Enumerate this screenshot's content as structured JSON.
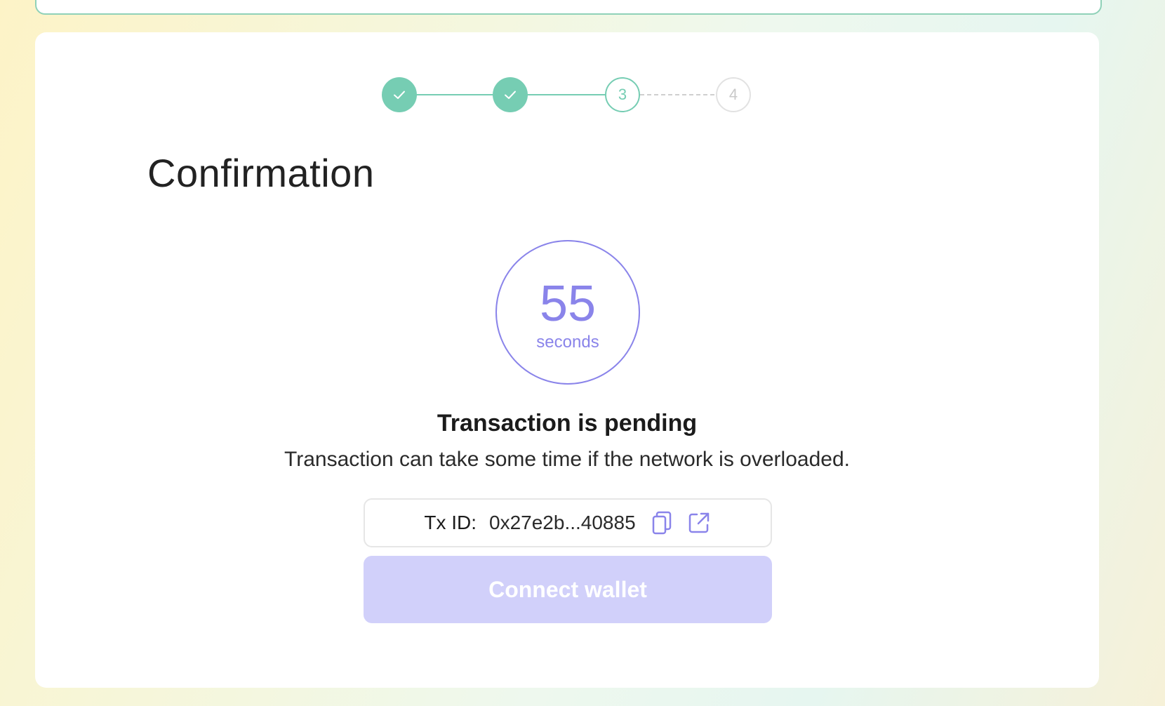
{
  "stepper": {
    "steps": [
      {
        "label": "",
        "state": "done"
      },
      {
        "label": "",
        "state": "done"
      },
      {
        "label": "3",
        "state": "current"
      },
      {
        "label": "4",
        "state": "todo"
      }
    ]
  },
  "page": {
    "title": "Confirmation"
  },
  "timer": {
    "value": "55",
    "unit": "seconds"
  },
  "status": {
    "title": "Transaction is pending",
    "description": "Transaction can take some time if the network is overloaded."
  },
  "transaction": {
    "label": "Tx ID:",
    "id": "0x27e2b...40885",
    "copy_icon": "copy-icon",
    "open_icon": "external-link-icon"
  },
  "actions": {
    "connect_label": "Connect wallet"
  },
  "colors": {
    "accent_green": "#76cdb3",
    "accent_purple": "#8a84ea",
    "button_disabled": "#d1d0fa"
  }
}
